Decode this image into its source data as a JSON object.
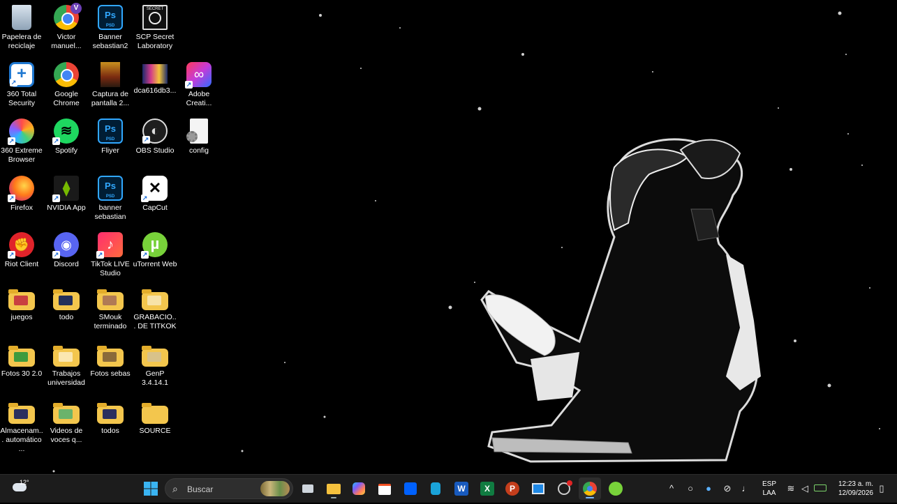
{
  "desktop": {
    "icons": [
      {
        "label": "Papelera de reciclaje",
        "icon": "recycle-bin-icon"
      },
      {
        "label": "Victor manuel...",
        "icon": "chrome-profile-icon",
        "badge": "V"
      },
      {
        "label": "Banner sebastian2",
        "icon": "photoshop-file-icon",
        "ps": "Ps",
        "psd": "PSD"
      },
      {
        "label": "SCP Secret Laboratory",
        "icon": "scp-game-icon"
      },
      {
        "label": "360 Total Security",
        "icon": "360-total-security-icon"
      },
      {
        "label": "Google Chrome",
        "icon": "chrome-icon"
      },
      {
        "label": "Captura de pantalla 2...",
        "icon": "image-thumbnail-icon"
      },
      {
        "label": "dca616db3...",
        "icon": "image-thumbnail-icon"
      },
      {
        "label": "Adobe Creati...",
        "icon": "adobe-creative-cloud-icon"
      },
      {
        "label": "360 Extreme Browser",
        "icon": "360-browser-icon"
      },
      {
        "label": "Spotify",
        "icon": "spotify-icon"
      },
      {
        "label": "Fliyer",
        "icon": "photoshop-file-icon",
        "ps": "Ps",
        "psd": "PSD"
      },
      {
        "label": "OBS Studio",
        "icon": "obs-studio-icon"
      },
      {
        "label": "config",
        "icon": "config-file-icon"
      },
      {
        "label": "Firefox",
        "icon": "firefox-icon"
      },
      {
        "label": "NVIDIA App",
        "icon": "nvidia-icon"
      },
      {
        "label": "banner sebastian",
        "icon": "photoshop-file-icon",
        "ps": "Ps",
        "psd": "PSD"
      },
      {
        "label": "CapCut",
        "icon": "capcut-icon"
      },
      {
        "label": "Riot Client",
        "icon": "riot-client-icon"
      },
      {
        "label": "Discord",
        "icon": "discord-icon"
      },
      {
        "label": "TikTok LIVE Studio",
        "icon": "tiktok-live-icon"
      },
      {
        "label": "uTorrent Web",
        "icon": "utorrent-icon"
      },
      {
        "label": "juegos",
        "icon": "folder-icon"
      },
      {
        "label": "todo",
        "icon": "folder-icon"
      },
      {
        "label": "SMouk terminado",
        "icon": "folder-icon"
      },
      {
        "label": "GRABACIO... DE TITKOK",
        "icon": "folder-icon"
      },
      {
        "label": "Fotos 30 2.0",
        "icon": "folder-icon"
      },
      {
        "label": "Trabajos universidad",
        "icon": "folder-icon"
      },
      {
        "label": "Fotos sebas",
        "icon": "folder-icon"
      },
      {
        "label": "GenP 3.4.14.1",
        "icon": "folder-icon"
      },
      {
        "label": "Almacenam... automático ...",
        "icon": "folder-icon"
      },
      {
        "label": "Videos de voces q...",
        "icon": "folder-icon"
      },
      {
        "label": "todos",
        "icon": "folder-icon"
      },
      {
        "label": "SOURCE",
        "icon": "folder-icon"
      }
    ],
    "scp_logo_text": "SECRET",
    "app_glyphs": {
      "nvidia": "⧫",
      "capcut": "✕",
      "riot": "✊",
      "discord": "◉",
      "tiktok": "♪",
      "utorrent": "µ",
      "spotify": "≋",
      "obs": "◐",
      "firefox": "🦊",
      "add": "+",
      "adobe": "∞"
    }
  },
  "taskbar": {
    "weather": {
      "temp": "12°",
      "icon": "cloud-sun-icon"
    },
    "search": {
      "placeholder": "Buscar"
    },
    "apps": [
      "windows-start-icon",
      "task-view-icon",
      "file-explorer-icon",
      "copilot-icon",
      "microsoft-store-icon",
      "dropbox-icon",
      "teams-icon",
      "word-icon",
      "excel-icon",
      "powerpoint-icon",
      "media-player-icon",
      "chrome-notification-icon",
      "chrome-profile-icon",
      "utorrent-icon"
    ],
    "app_glyphs": {
      "word": "W",
      "excel": "X",
      "powerpoint": "P"
    },
    "tray": {
      "lang_top": "ESP",
      "lang_bottom": "LAA",
      "time": "12:23 a. m.",
      "date": "12/09/2026"
    }
  },
  "colors": {
    "desktop_bg": "#000000",
    "taskbar_bg": "#1c1c1c",
    "folder": "#f3c64d"
  }
}
